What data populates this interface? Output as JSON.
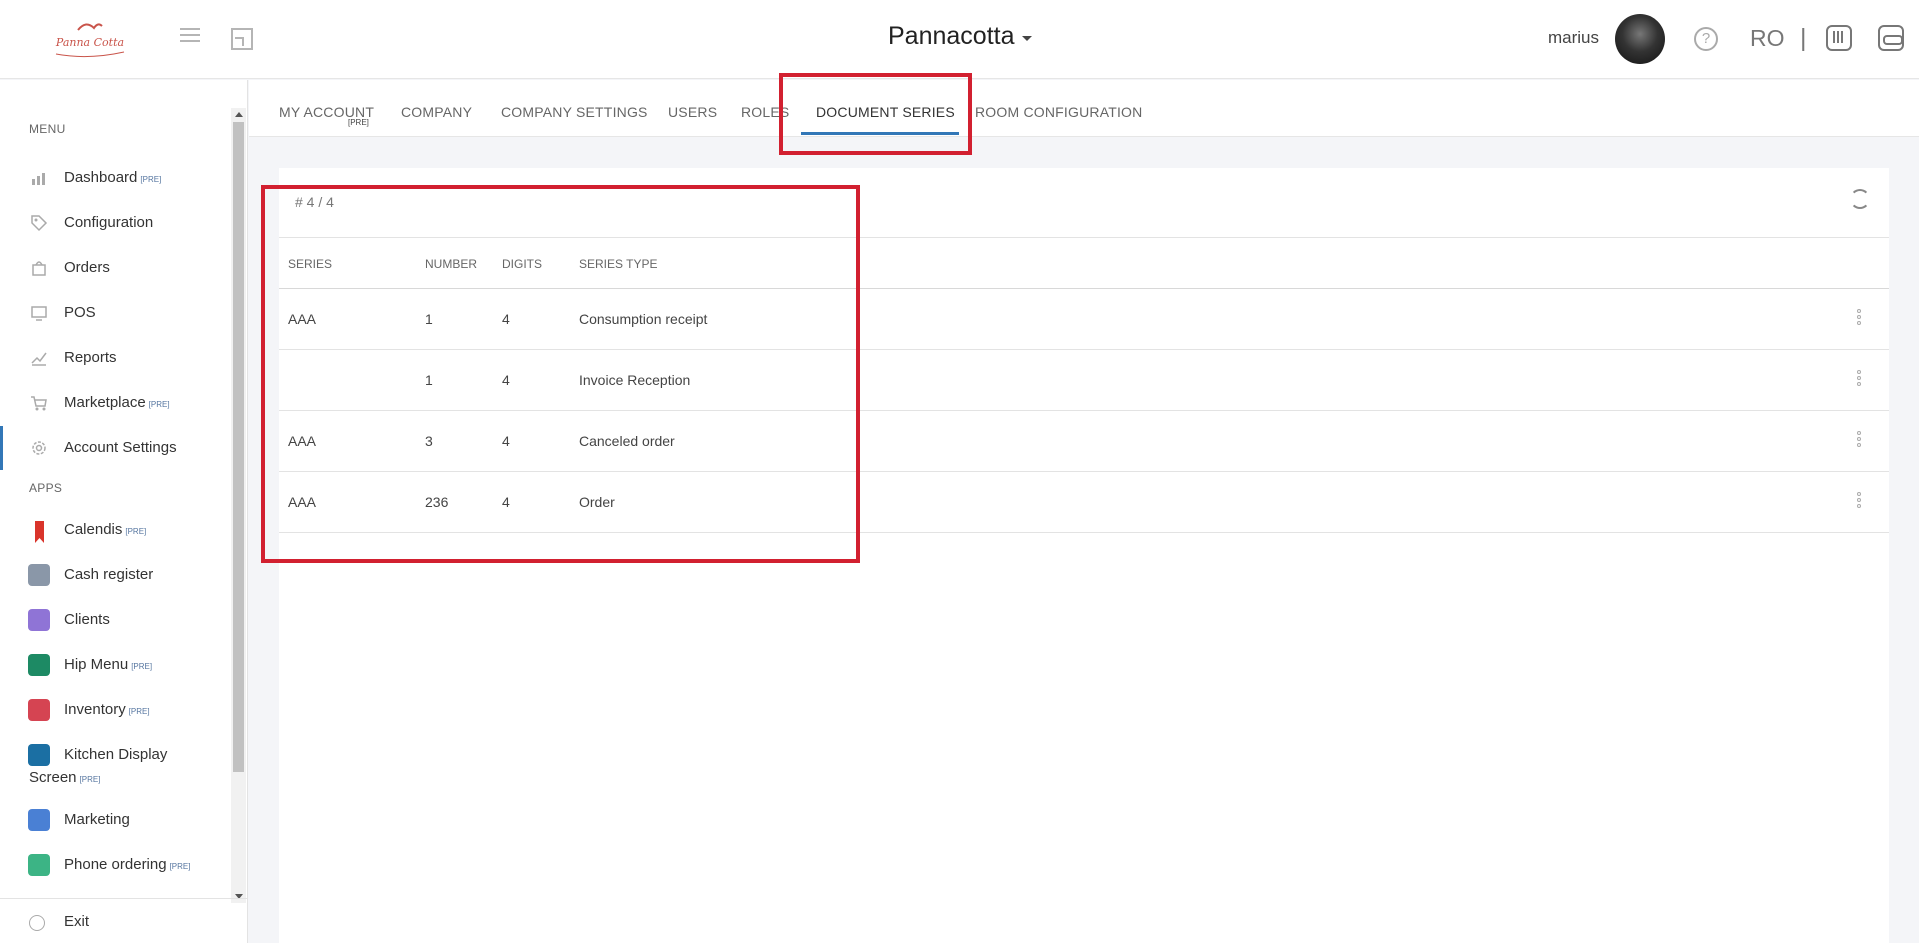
{
  "header": {
    "logo_text": "Panna Cotta",
    "brand": "Pannacotta",
    "username": "marius",
    "language": "RO",
    "separator": "|"
  },
  "sidebar": {
    "menu_label": "MENU",
    "menu_items": [
      {
        "label": "Dashboard",
        "pre": "[PRE]",
        "icon": "bar-chart-icon"
      },
      {
        "label": "Configuration",
        "pre": "",
        "icon": "tag-icon"
      },
      {
        "label": "Orders",
        "pre": "",
        "icon": "bag-icon"
      },
      {
        "label": "POS",
        "pre": "",
        "icon": "monitor-icon"
      },
      {
        "label": "Reports",
        "pre": "",
        "icon": "line-chart-icon"
      },
      {
        "label": "Marketplace",
        "pre": "[PRE]",
        "icon": "cart-icon"
      },
      {
        "label": "Account Settings",
        "pre": "",
        "icon": "gear-icon"
      }
    ],
    "apps_label": "APPS",
    "app_items": [
      {
        "label": "Calendis",
        "pre": "[PRE]",
        "color": "#d9342b"
      },
      {
        "label": "Cash register",
        "pre": "",
        "color": "#8a97a8"
      },
      {
        "label": "Clients",
        "pre": "",
        "color": "#8f74d6"
      },
      {
        "label": "Hip Menu",
        "pre": "[PRE]",
        "color": "#1d8a64"
      },
      {
        "label": "Inventory",
        "pre": "[PRE]",
        "color": "#d54452"
      },
      {
        "label": "Kitchen Display",
        "label2": "Screen",
        "pre": "[PRE]",
        "color": "#1b6fa3"
      },
      {
        "label": "Marketing",
        "pre": "",
        "color": "#4a80d4"
      },
      {
        "label": "Phone ordering",
        "pre": "[PRE]",
        "color": "#3cb485"
      }
    ],
    "exit_label": "Exit"
  },
  "tabs": [
    {
      "label": "MY ACCOUNT"
    },
    {
      "label": "COMPANY"
    },
    {
      "label": "COMPANY SETTINGS"
    },
    {
      "label": "USERS"
    },
    {
      "label": "ROLES"
    },
    {
      "label": "DOCUMENT SERIES"
    },
    {
      "label": "ROOM CONFIGURATION"
    }
  ],
  "tab_pre": "[PRE]",
  "active_tab": "DOCUMENT SERIES",
  "table": {
    "count": "# 4 / 4",
    "columns": [
      "SERIES",
      "NUMBER",
      "DIGITS",
      "SERIES TYPE"
    ],
    "rows": [
      {
        "series": "AAA",
        "number": "1",
        "digits": "4",
        "type": "Consumption receipt"
      },
      {
        "series": "",
        "number": "1",
        "digits": "4",
        "type": "Invoice Reception"
      },
      {
        "series": "AAA",
        "number": "3",
        "digits": "4",
        "type": "Canceled order"
      },
      {
        "series": "AAA",
        "number": "236",
        "digits": "4",
        "type": "Order"
      }
    ]
  },
  "colors": {
    "accent": "#3277b7",
    "highlight": "#d22030"
  }
}
